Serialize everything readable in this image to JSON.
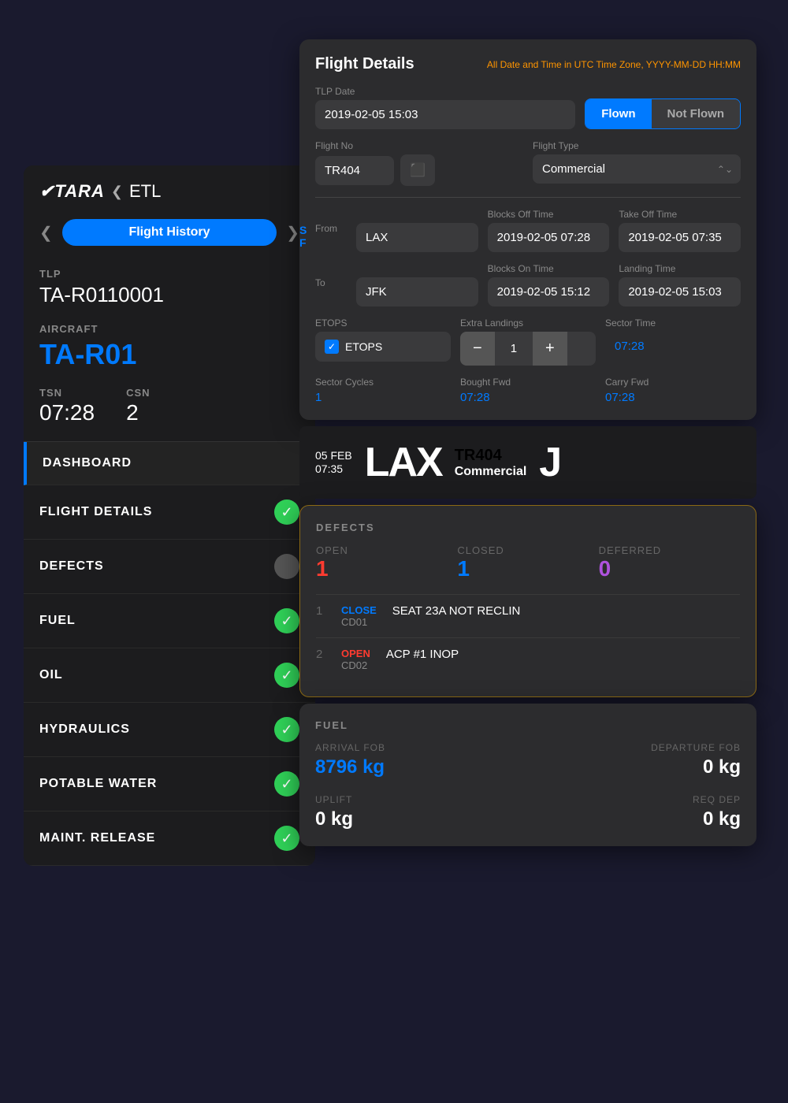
{
  "app": {
    "logo": "✈TARA",
    "logo_chevron": "❮",
    "section": "ETL"
  },
  "nav": {
    "prev_arrow": "❮",
    "next_arrow": "❯",
    "flight_history_label": "Flight History"
  },
  "left_panel": {
    "tlp_label": "TLP",
    "tlp_value": "TA-R0110001",
    "aircraft_label": "AIRCRAFT",
    "aircraft_value": "TA-R01",
    "tsn_label": "TSN",
    "tsn_value": "07:28",
    "csn_label": "CSN",
    "csn_value": "2",
    "menu_items": [
      {
        "id": "dashboard",
        "label": "DASHBOARD",
        "status": "active",
        "icon": null
      },
      {
        "id": "flight_details",
        "label": "FLIGHT DETAILS",
        "status": "green",
        "icon": "✓"
      },
      {
        "id": "defects",
        "label": "DEFECTS",
        "status": "gray",
        "icon": null
      },
      {
        "id": "fuel",
        "label": "FUEL",
        "status": "green",
        "icon": "✓"
      },
      {
        "id": "oil",
        "label": "OIL",
        "status": "green",
        "icon": "✓"
      },
      {
        "id": "hydraulics",
        "label": "HYDRAULICS",
        "status": "green",
        "icon": "✓"
      },
      {
        "id": "potable_water",
        "label": "POTABLE WATER",
        "status": "green",
        "icon": "✓"
      },
      {
        "id": "maint_release",
        "label": "MAINT. RELEASE",
        "status": "green",
        "icon": "✓"
      }
    ]
  },
  "flight_details": {
    "title": "Flight Details",
    "utc_note": "All Date and Time in UTC Time Zone, YYYY-MM-DD HH:MM",
    "tlp_date_label": "TLP Date",
    "tlp_date_value": "2019-02-05 15:03",
    "flown_label": "Flown",
    "not_flown_label": "Not Flown",
    "flight_no_label": "Flight No",
    "flight_no_value": "TR404",
    "flight_type_label": "Flight Type",
    "flight_type_value": "Commercial",
    "from_label": "From",
    "from_value": "LAX",
    "blocks_off_label": "Blocks Off Time",
    "blocks_off_value": "2019-02-05 07:28",
    "takeoff_label": "Take Off Time",
    "takeoff_value": "2019-02-05 07:35",
    "to_label": "To",
    "to_value": "JFK",
    "blocks_on_label": "Blocks On Time",
    "blocks_on_value": "2019-02-05 15:12",
    "landing_label": "Landing Time",
    "landing_value": "2019-02-05 15:03",
    "etops_label": "ETOPS",
    "etops_checked": true,
    "extra_landings_label": "Extra Landings",
    "extra_landings_value": "1",
    "sector_time_label": "Sector Time",
    "sector_time_value": "07:28",
    "sector_cycles_label": "Sector Cycles",
    "sector_cycles_value": "1",
    "bought_fwd_label": "Bought Fwd",
    "bought_fwd_value": "07:28",
    "carry_fwd_label": "Carry Fwd",
    "carry_fwd_value": "07:28"
  },
  "flight_summary": {
    "date_line1": "05 FEB",
    "date_line2": "07:35",
    "airport": "LAX",
    "flight_no": "TR404",
    "type": "Commercial",
    "destination_initial": "J"
  },
  "defects": {
    "title": "DEFECTS",
    "open_label": "OPEN",
    "closed_label": "CLOSED",
    "deferred_label": "DEFERRED",
    "open_count": "1",
    "closed_count": "1",
    "deferred_count": "0",
    "items": [
      {
        "num": "1",
        "status": "CLOSE",
        "code": "CD01",
        "description": "SEAT 23A NOT RECLIN"
      },
      {
        "num": "2",
        "status": "OPEN",
        "code": "CD02",
        "description": "ACP #1 INOP"
      }
    ]
  },
  "fuel": {
    "title": "FUEL",
    "arrival_fob_label": "ARRIVAL FOB",
    "arrival_fob_value": "8796",
    "arrival_fob_unit": "kg",
    "departure_fob_label": "DEPARTURE FOB",
    "departure_fob_value": "0",
    "departure_fob_unit": "kg",
    "uplift_label": "UPLIFT",
    "uplift_value": "0",
    "uplift_unit": "kg",
    "req_dep_label": "REQ DEP",
    "req_dep_value": "0",
    "req_dep_unit": "kg"
  },
  "colors": {
    "blue": "#007AFF",
    "green": "#30d158",
    "red": "#FF3B30",
    "orange": "#FF9500",
    "purple": "#AF52DE",
    "dark_bg": "#1c1c1e",
    "card_bg": "#2c2c2e",
    "input_bg": "#3a3a3c"
  }
}
